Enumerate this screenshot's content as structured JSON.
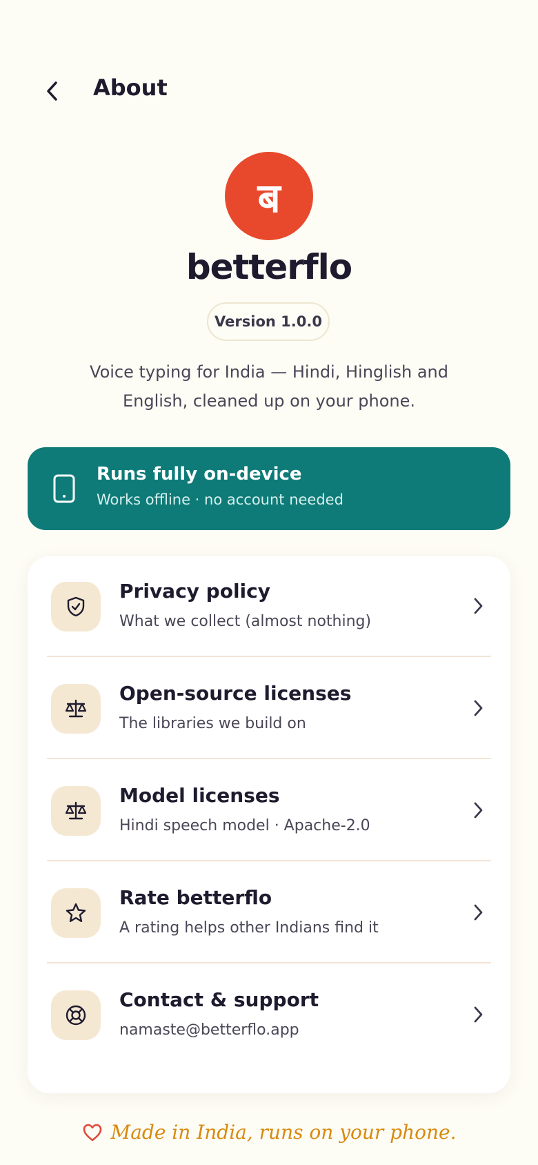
{
  "header": {
    "title": "About",
    "back_icon": "back-arrow-icon"
  },
  "app": {
    "logo_glyph": "ब",
    "name": "betterflo",
    "version": "Version 1.0.0",
    "tagline": "Voice typing for India — Hindi, Hinglish and English, cleaned up on your phone."
  },
  "banner": {
    "title": "Runs fully on-device",
    "subtitle": "Works offline · no account needed",
    "icon": "phone-icon",
    "color": "#0e7b78"
  },
  "items": [
    {
      "title": "Privacy policy",
      "subtitle": "What we collect (almost nothing)",
      "icon": "shield-check-icon"
    },
    {
      "title": "Open-source licenses",
      "subtitle": "The libraries we build on",
      "icon": "scale-icon"
    },
    {
      "title": "Model licenses",
      "subtitle": "Hindi speech model · Apache-2.0",
      "icon": "scale-icon"
    },
    {
      "title": "Rate betterflo",
      "subtitle": "A rating helps other Indians find it",
      "icon": "star-icon"
    },
    {
      "title": "Contact & support",
      "subtitle": "namaste@betterflo.app",
      "icon": "lifebuoy-icon"
    }
  ],
  "footer": {
    "text": "Made in India, runs on your phone.",
    "icon": "heart-icon"
  },
  "colors": {
    "accent": "#e8492c",
    "teal": "#0e7b78",
    "footer": "#d88a0f",
    "background": "#fdfcf5"
  }
}
